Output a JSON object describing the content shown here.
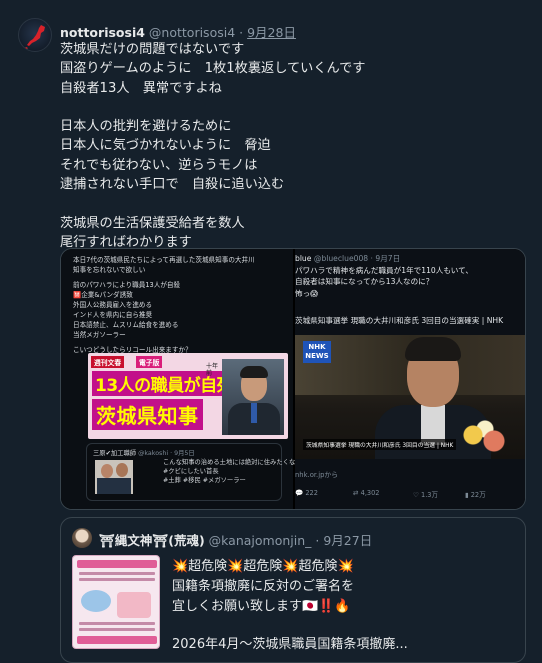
{
  "tweet": {
    "display_name": "nottorisosi4",
    "handle": "@nottorisosi4",
    "separator": "·",
    "date": "9月28日",
    "lines": [
      "茨城県だけの問題ではないです",
      "国盗りゲームのように　1枚1枚裏返していくんです",
      "自殺者13人　異常ですよね",
      "",
      "日本人の批判を避けるために",
      "日本人に気づかれないように　脅迫",
      "それでも従わない、逆らうモノは",
      "逮捕されない手口で　自殺に追い込む",
      "",
      "茨城県の生活保護受給者を数人",
      "尾行すればわかります"
    ]
  },
  "media_left": {
    "text_lines": [
      "本日7代の茨城県民たちによって再選した茨城県知事の大井川",
      "知事を忘れないで欲しい",
      "",
      "前のパワハラにより職員13人が自殺",
      "🈲企業&パンダ誘致",
      "外国人公務員雇入を進める",
      "インド人を県内に自ら推奨",
      "日本語禁止、ムスリム給食を進める",
      "当然メガソーラー",
      "",
      "こいつどうしたらリコール出来ますか？"
    ],
    "magazine": {
      "tag1": "週刊文春",
      "tag2": "電子版",
      "headline1": "13人の職員が自死",
      "headline2": "茨城県知事",
      "side": "十年前"
    },
    "quote_card": {
      "name": "三原✔加工職師",
      "handle": "@kakoshi · 9月5日",
      "lines": [
        "こんな知事の治める土地には絶対に住みたくない。",
        "#クビにしたい首長",
        "#土葬 #移民 #メガソーラー"
      ]
    }
  },
  "media_right": {
    "header_name": "blue",
    "header_handle": "@blueclue008 · 9月7日",
    "lines": [
      "パワハラで精神を病んだ職員が1年で110人もいて、",
      "自殺者は知事になってから13人なのに？",
      "怖っ😱"
    ],
    "headline": "茨城県知事選挙 現職の大井川和彦氏 3回目の当選確実 | NHK",
    "nhk_badge_top": "NHK",
    "nhk_badge_bottom": "NEWS",
    "caption": "茨城県知事選挙 現職の大井川和彦氏 3回目の当選 | NHK",
    "link": "nhk.or.jpから",
    "actions": {
      "replies": "222",
      "retweets": "4,302",
      "likes": "1.3万",
      "views": "22万"
    }
  },
  "quoted": {
    "display_name": "⛩縄文神⛩(荒魂)",
    "handle": "@kanajomonjin_",
    "separator": "·",
    "date": "9月27日",
    "lines": [
      "💥超危険💥超危険💥超危険💥",
      "国籍条項撤廃に反対のご署名を",
      "宜しくお願い致します🇯🇵‼️🔥",
      "",
      "2026年4月〜茨城県職員国籍条項撤廃..."
    ]
  }
}
